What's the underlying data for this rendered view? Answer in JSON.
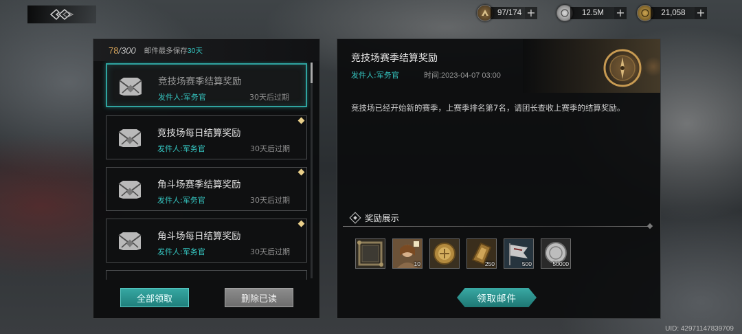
{
  "resources": [
    {
      "icon": "stamina-icon",
      "value": "97/174"
    },
    {
      "icon": "silver-coin-icon",
      "value": "12.5M"
    },
    {
      "icon": "gold-coin-icon",
      "value": "21,058"
    }
  ],
  "mailbox": {
    "count_current": "78",
    "count_total": "/300",
    "keep_note_prefix": "邮件最多保存",
    "keep_note_days": "30天",
    "mails": [
      {
        "title": "竞技场赛季结算奖励",
        "sender": "发件人:军务官",
        "expire": "30天后过期",
        "selected": true,
        "unread": false
      },
      {
        "title": "竞技场每日结算奖励",
        "sender": "发件人:军务官",
        "expire": "30天后过期",
        "selected": false,
        "unread": true
      },
      {
        "title": "角斗场赛季结算奖励",
        "sender": "发件人:军务官",
        "expire": "30天后过期",
        "selected": false,
        "unread": true
      },
      {
        "title": "角斗场每日结算奖励",
        "sender": "发件人:军务官",
        "expire": "30天后过期",
        "selected": false,
        "unread": true
      }
    ],
    "collect_all_label": "全部领取",
    "delete_read_label": "删除已读"
  },
  "detail": {
    "title": "竞技场赛季结算奖励",
    "sender": "发件人:军务官",
    "time": "时间:2023-04-07 03:00",
    "body": "竞技场已经开始新的赛季，上赛季排名第7名，请团长查收上赛季的结算奖励。",
    "rewards_label": "奖励展示",
    "rewards": [
      {
        "icon": "portrait-frame-icon",
        "qty": ""
      },
      {
        "icon": "hero-portrait-icon",
        "qty": "10"
      },
      {
        "icon": "gold-medal-icon",
        "qty": ""
      },
      {
        "icon": "bronze-medal-icon",
        "qty": "250"
      },
      {
        "icon": "banner-flag-icon",
        "qty": "500"
      },
      {
        "icon": "silver-coin-icon",
        "qty": "50000"
      }
    ],
    "claim_label": "领取邮件"
  },
  "uid": "UID: 42971147839709",
  "colors": {
    "accent": "#35c6c1",
    "count": "#d9a55a"
  }
}
